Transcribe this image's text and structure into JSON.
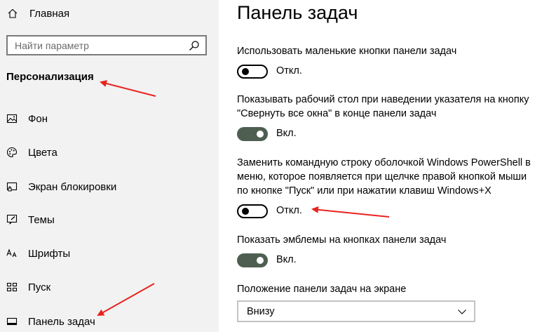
{
  "sidebar": {
    "home_label": "Главная",
    "search_placeholder": "Найти параметр",
    "section_title": "Персонализация",
    "items": [
      {
        "label": "Фон",
        "icon": "picture-icon"
      },
      {
        "label": "Цвета",
        "icon": "palette-icon"
      },
      {
        "label": "Экран блокировки",
        "icon": "lock-screen-icon"
      },
      {
        "label": "Темы",
        "icon": "brush-icon"
      },
      {
        "label": "Шрифты",
        "icon": "font-icon"
      },
      {
        "label": "Пуск",
        "icon": "start-icon"
      },
      {
        "label": "Панель задач",
        "icon": "taskbar-icon"
      }
    ]
  },
  "main": {
    "title": "Панель задач",
    "settings": [
      {
        "lines": [
          "Использовать маленькие кнопки панели задач"
        ],
        "state": "off",
        "state_label": "Откл."
      },
      {
        "lines": [
          "Показывать рабочий стол при наведении указателя на кнопку",
          "\"Свернуть все окна\" в конце панели задач"
        ],
        "state": "on",
        "state_label": "Вкл."
      },
      {
        "lines": [
          "Заменить командную строку оболочкой Windows PowerShell в",
          "меню, которое появляется при щелчке правой кнопкой мыши",
          "по кнопке \"Пуск\" или при нажатии клавиш Windows+X"
        ],
        "state": "off",
        "state_label": "Откл."
      },
      {
        "lines": [
          "Показать эмблемы на кнопках панели задач"
        ],
        "state": "on",
        "state_label": "Вкл."
      }
    ],
    "position_label": "Положение панели задач на экране",
    "position_value": "Внизу"
  },
  "colors": {
    "sidebar_bg": "#f2f2f2",
    "toggle_on": "#4e5f52",
    "arrow": "#e8231f"
  }
}
